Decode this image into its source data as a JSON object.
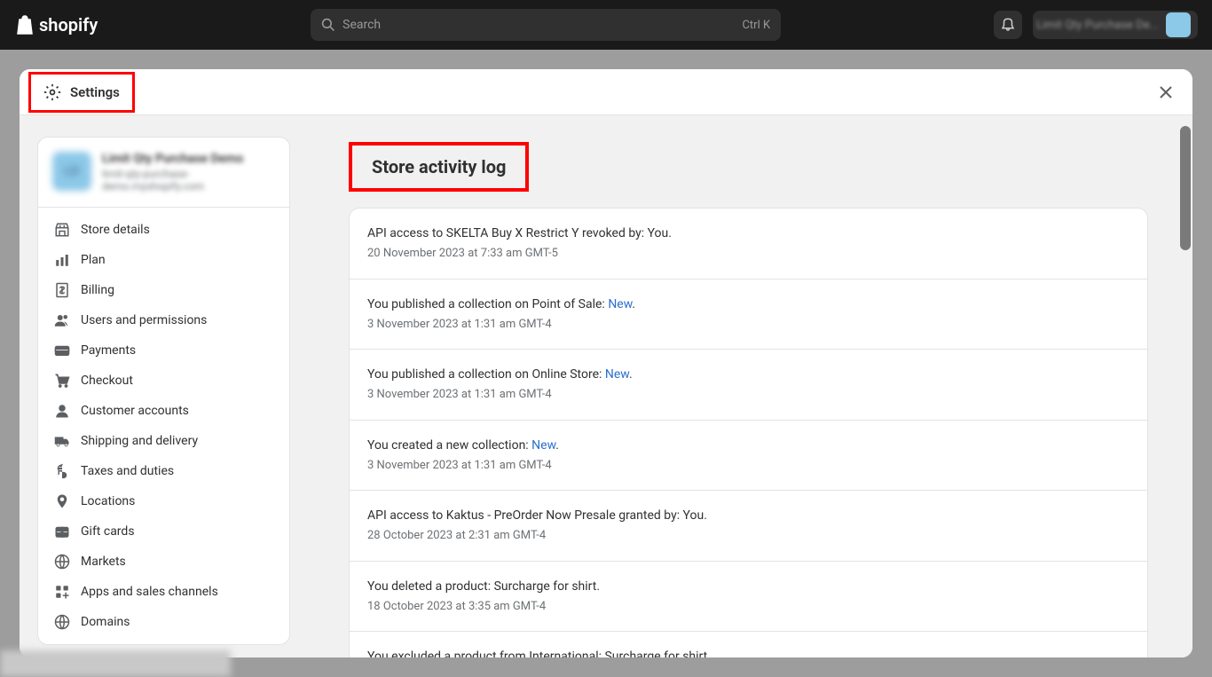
{
  "topbar": {
    "logo_text": "shopify",
    "search_placeholder": "Search",
    "search_shortcut": "Ctrl K",
    "store_badge": "Limit Qty Purchase De..."
  },
  "modal": {
    "header_title": "Settings"
  },
  "store_card": {
    "name": "Limit Qty Purchase Demo",
    "url": "limit-qty-purchase-demo.myshopify.com",
    "avatar_text": "LD"
  },
  "nav": {
    "items": [
      {
        "label": "Store details"
      },
      {
        "label": "Plan"
      },
      {
        "label": "Billing"
      },
      {
        "label": "Users and permissions"
      },
      {
        "label": "Payments"
      },
      {
        "label": "Checkout"
      },
      {
        "label": "Customer accounts"
      },
      {
        "label": "Shipping and delivery"
      },
      {
        "label": "Taxes and duties"
      },
      {
        "label": "Locations"
      },
      {
        "label": "Gift cards"
      },
      {
        "label": "Markets"
      },
      {
        "label": "Apps and sales channels"
      },
      {
        "label": "Domains"
      }
    ]
  },
  "content": {
    "title": "Store activity log",
    "entries": [
      {
        "text": "API access to SKELTA Buy X Restrict Y revoked by: You.",
        "link": "",
        "suffix": "",
        "date": "20 November 2023 at 7:33 am GMT-5"
      },
      {
        "text": "You published a collection on Point of Sale: ",
        "link": "New",
        "suffix": ".",
        "date": "3 November 2023 at 1:31 am GMT-4"
      },
      {
        "text": "You published a collection on Online Store: ",
        "link": "New",
        "suffix": ".",
        "date": "3 November 2023 at 1:31 am GMT-4"
      },
      {
        "text": "You created a new collection: ",
        "link": "New",
        "suffix": ".",
        "date": "3 November 2023 at 1:31 am GMT-4"
      },
      {
        "text": "API access to Kaktus - PreOrder Now Presale granted by: You.",
        "link": "",
        "suffix": "",
        "date": "28 October 2023 at 2:31 am GMT-4"
      },
      {
        "text": "You deleted a product: Surcharge for shirt.",
        "link": "",
        "suffix": "",
        "date": "18 October 2023 at 3:35 am GMT-4"
      },
      {
        "text": "You excluded a product from International: Surcharge for shirt.",
        "link": "",
        "suffix": "",
        "date": ""
      }
    ]
  }
}
